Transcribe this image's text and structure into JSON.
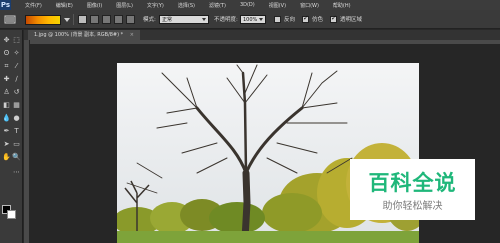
{
  "app": {
    "logo": "Ps"
  },
  "menu": [
    "文件(F)",
    "编辑(E)",
    "图像(I)",
    "图层(L)",
    "文字(Y)",
    "选择(S)",
    "滤镜(T)",
    "3D(D)",
    "视图(V)",
    "窗口(W)",
    "帮助(H)"
  ],
  "options": {
    "mode_label": "模式:",
    "mode_value": "正常",
    "opacity_label": "不透明度:",
    "opacity_value": "100%",
    "reverse_label": "反向",
    "dither_label": "仿色",
    "transparency_label": "透明区域"
  },
  "document": {
    "tab_title": "1.jpg @ 100% (背景 副本, RGB/8#) *",
    "tab_close": "×"
  },
  "watermark": {
    "title": "百科全说",
    "subtitle": "助你轻松解决"
  },
  "colors": {
    "accent": "#1fb77a",
    "foreground_swatch": "#000000",
    "background_swatch": "#ffffff"
  }
}
